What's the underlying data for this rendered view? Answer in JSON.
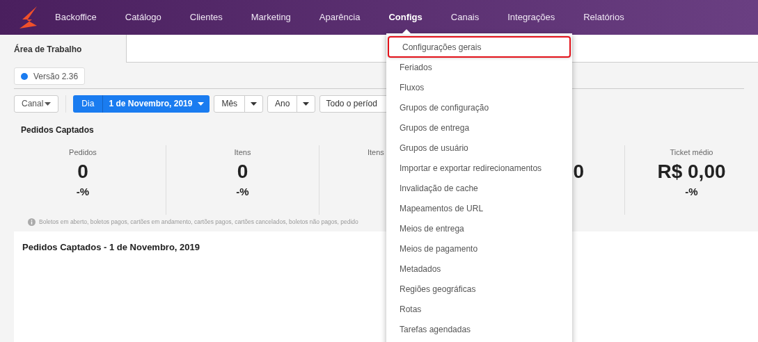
{
  "nav": {
    "items": [
      {
        "label": "Backoffice",
        "selected": false
      },
      {
        "label": "Catálogo",
        "selected": false
      },
      {
        "label": "Clientes",
        "selected": false
      },
      {
        "label": "Marketing",
        "selected": false
      },
      {
        "label": "Aparência",
        "selected": false
      },
      {
        "label": "Configs",
        "selected": true
      },
      {
        "label": "Canais",
        "selected": false
      },
      {
        "label": "Integrações",
        "selected": false
      },
      {
        "label": "Relatórios",
        "selected": false
      }
    ]
  },
  "tabs": [
    {
      "label": "Área de Trabalho",
      "selected": true
    }
  ],
  "version": {
    "label": "Versão 2.36",
    "color": "#1a7cf0"
  },
  "filters": {
    "channel": "Canal",
    "day": {
      "label": "Dia",
      "value": "1 de Novembro, 2019"
    },
    "month": "Mês",
    "year": "Ano",
    "all": "Todo o períod"
  },
  "section_title": "Pedidos Captados",
  "stats": [
    {
      "label": "Pedidos",
      "value": "0",
      "change": "-%"
    },
    {
      "label": "Itens",
      "value": "0",
      "change": "-%"
    },
    {
      "label": "Itens"
    },
    {
      "value": "0"
    },
    {
      "label": "Ticket médio",
      "value": "R$ 0,00",
      "change": "-%"
    }
  ],
  "info_note": "Boletos em aberto, boletos pagos, cartões em andamento, cartões pagos, cartões cancelados, boletos não pagos, pedido",
  "panel_title": "Pedidos Captados - 1 de Novembro, 2019",
  "menu": {
    "items": [
      {
        "label": "Configurações gerais",
        "selected": true
      },
      {
        "label": "Feriados",
        "selected": false
      },
      {
        "label": "Fluxos",
        "selected": false
      },
      {
        "label": "Grupos de configuração",
        "selected": false
      },
      {
        "label": "Grupos de entrega",
        "selected": false
      },
      {
        "label": "Grupos de usuário",
        "selected": false
      },
      {
        "label": "Importar e exportar redirecionamentos",
        "selected": false
      },
      {
        "label": "Invalidação de cache",
        "selected": false
      },
      {
        "label": "Mapeamentos de URL",
        "selected": false
      },
      {
        "label": "Meios de entrega",
        "selected": false
      },
      {
        "label": "Meios de pagamento",
        "selected": false
      },
      {
        "label": "Metadados",
        "selected": false
      },
      {
        "label": "Regiões geográficas",
        "selected": false
      },
      {
        "label": "Rotas",
        "selected": false
      },
      {
        "label": "Tarefas agendadas",
        "selected": false
      }
    ]
  }
}
